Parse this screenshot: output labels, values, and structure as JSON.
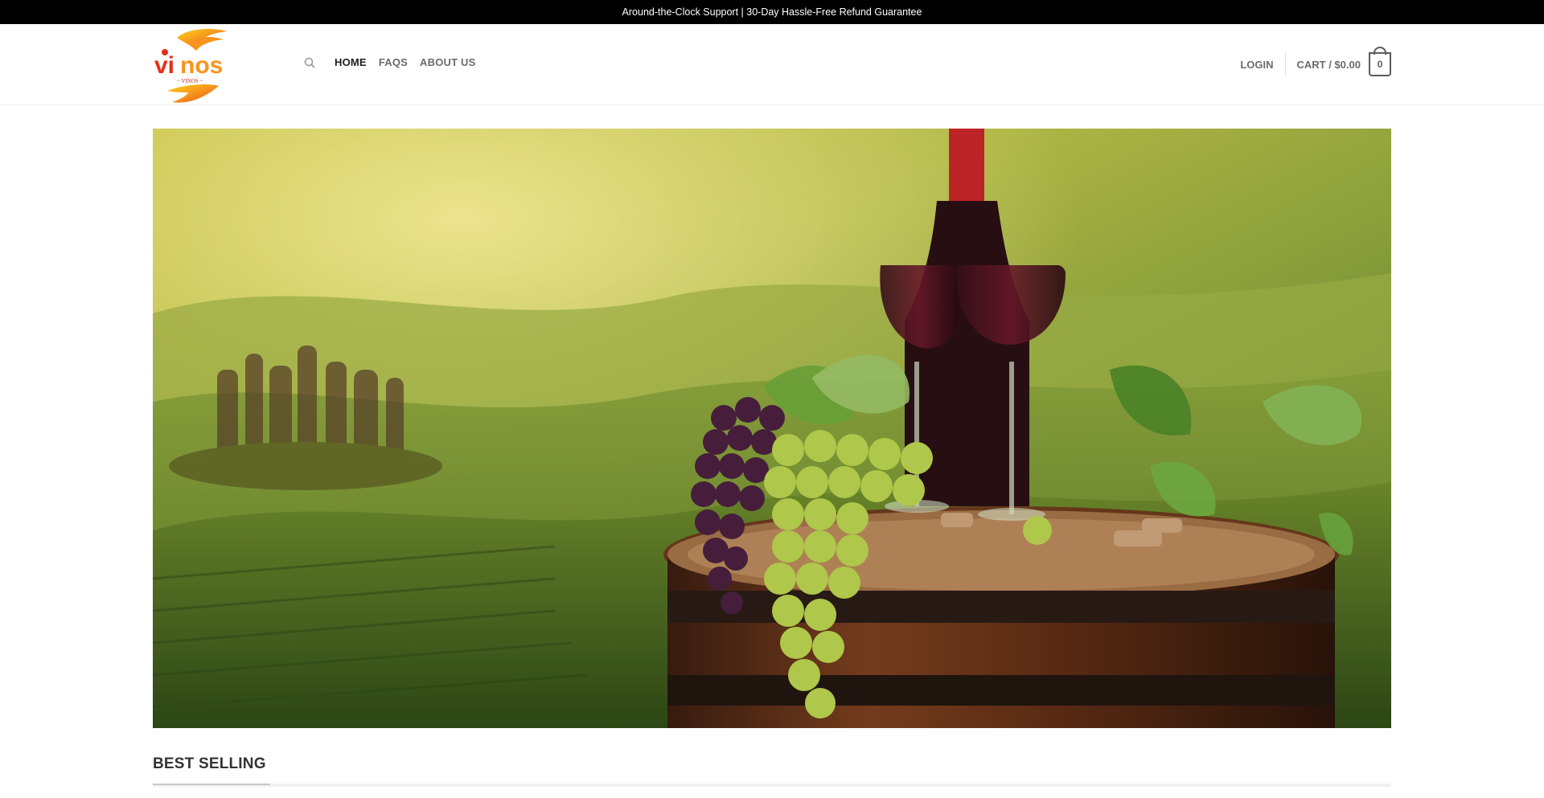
{
  "topbar": {
    "announcement": "Around-the-Clock Support | 30-Day Hassle-Free Refund Guarantee"
  },
  "logo": {
    "brand": "vinos",
    "tagline": "~ VINOS ~",
    "colors": {
      "primary": "#f28c1a",
      "secondary": "#e62e17",
      "accent": "#ffc21a"
    }
  },
  "nav": {
    "search_icon": "search-icon",
    "items": [
      {
        "label": "HOME",
        "active": true
      },
      {
        "label": "FAQS",
        "active": false
      },
      {
        "label": "ABOUT US",
        "active": false
      }
    ]
  },
  "header_right": {
    "login": "LOGIN",
    "cart_label": "CART / $0.00",
    "cart_count": "0"
  },
  "hero": {
    "image": "wine-vineyard-banner"
  },
  "section": {
    "title": "BEST SELLING"
  }
}
